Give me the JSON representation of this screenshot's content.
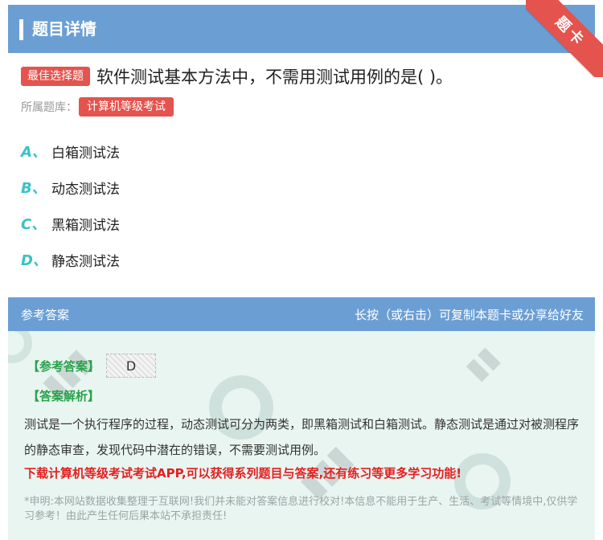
{
  "header": {
    "title": "题目详情",
    "ribbon": "题卡"
  },
  "question": {
    "tag": "最佳选择题",
    "text": "软件测试基本方法中，不需用测试用例的是( )。",
    "bank_label": "所属题库：",
    "bank_name": "计算机等级考试"
  },
  "options": [
    {
      "letter": "A、",
      "text": "白箱测试法"
    },
    {
      "letter": "B、",
      "text": "动态测试法"
    },
    {
      "letter": "C、",
      "text": "黑箱测试法"
    },
    {
      "letter": "D、",
      "text": "静态测试法"
    }
  ],
  "answer": {
    "header_left": "参考答案",
    "header_right": "长按（或右击）可复制本题卡或分享给好友",
    "ref_label": "【参考答案】",
    "ref_value": "D",
    "analysis_label": "【答案解析】",
    "explanation": "测试是一个执行程序的过程，动态测试可分为两类，即黑箱测试和白箱测试。静态测试是通过对被测程序的静态审查，发现代码中潜在的错误，不需要测试用例。",
    "promo": "下载计算机等级考试考试APP,可以获得系列题目与答案,还有练习等更多学习功能!",
    "disclaimer": "*申明:本网站数据收集整理于互联网!我们并未能对答案信息进行校对!本信息不能用于生产、生活、考试等情境中,仅供学习参考！由此产生任何后果本站不承担责任!"
  },
  "colors": {
    "header": "#6b9fd4",
    "accent": "#e4534d",
    "option_letter": "#3bc0c8",
    "green": "#27a24a",
    "promo": "#e41f1f"
  }
}
